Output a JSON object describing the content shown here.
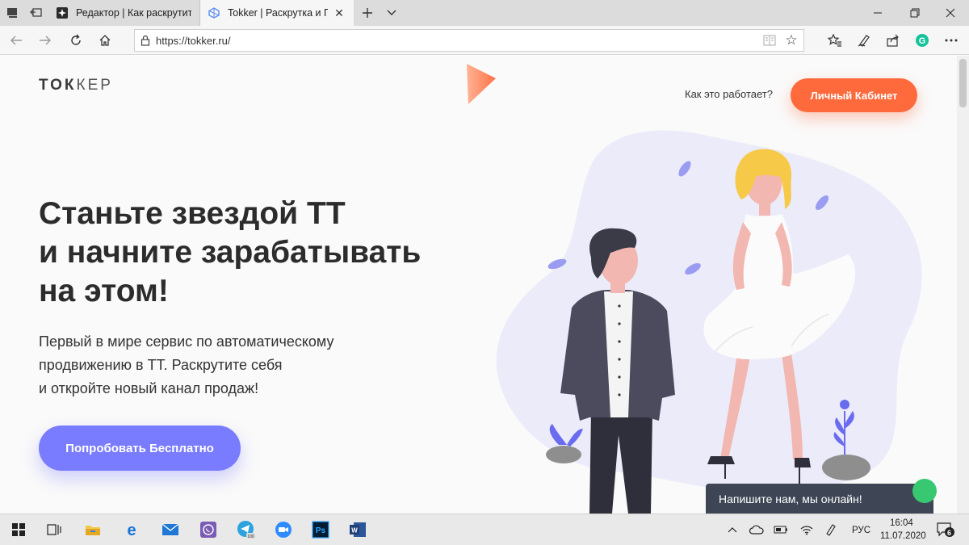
{
  "browser": {
    "tabs": [
      {
        "title": "Редактор | Как раскрутить",
        "active": false
      },
      {
        "title": "Tokker | Раскрутка и Пр",
        "active": true
      }
    ],
    "url": "https://tokker.ru/"
  },
  "site": {
    "logo_bold": "ТОК",
    "logo_light": "КЕР",
    "nav_how": "Как это работает?",
    "cabinet_button": "Личный Кабинет",
    "hero_title_lines": [
      "Станьте звездой ТТ",
      "и начните зарабатывать",
      "на этом!"
    ],
    "hero_sub_lines": [
      "Первый в мире сервис по автоматическому",
      "продвижению в ТТ. Раскрутите себя",
      "и откройте новый канал продаж!"
    ],
    "try_button": "Попробовать Бесплатно",
    "chat_text": "Напишите нам, мы онлайн!"
  },
  "taskbar": {
    "lang": "РУС",
    "time": "16:04",
    "date": "11.07.2020",
    "notifications": "6"
  },
  "colors": {
    "accent_orange": "#ff6a3d",
    "accent_purple": "#7a7cff",
    "chat_bg": "#3e4656",
    "online_green": "#37c871"
  }
}
